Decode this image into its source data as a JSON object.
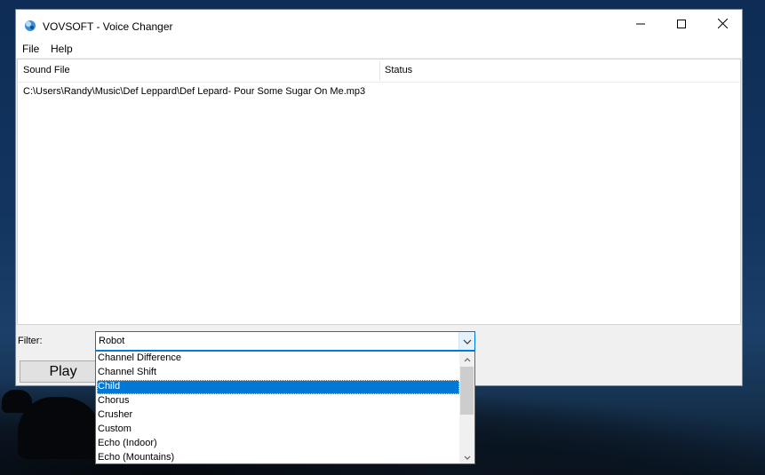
{
  "window": {
    "title": "VOVSOFT - Voice Changer"
  },
  "menu": {
    "file": "File",
    "help": "Help"
  },
  "list": {
    "columns": [
      "Sound File",
      "Status"
    ],
    "rows": [
      {
        "sound_file": "C:\\Users\\Randy\\Music\\Def Leppard\\Def Lepard- Pour Some Sugar On Me.mp3",
        "status": ""
      }
    ]
  },
  "filter": {
    "label": "Filter:",
    "value": "Robot",
    "options": [
      "Channel Difference",
      "Channel Shift",
      "Child",
      "Chorus",
      "Crusher",
      "Custom",
      "Echo (Indoor)",
      "Echo (Mountains)"
    ],
    "highlighted": "Child"
  },
  "actions": {
    "play": "Play"
  },
  "icons": {
    "app": "voice-changer-app-icon",
    "minimize": "minimize-icon",
    "maximize": "maximize-icon",
    "close": "close-icon",
    "dropdown": "chevron-down-icon",
    "scroll_up": "scroll-up-icon",
    "scroll_down": "scroll-down-icon"
  },
  "colors": {
    "accent": "#0078d7",
    "selection": "#0078d7"
  }
}
